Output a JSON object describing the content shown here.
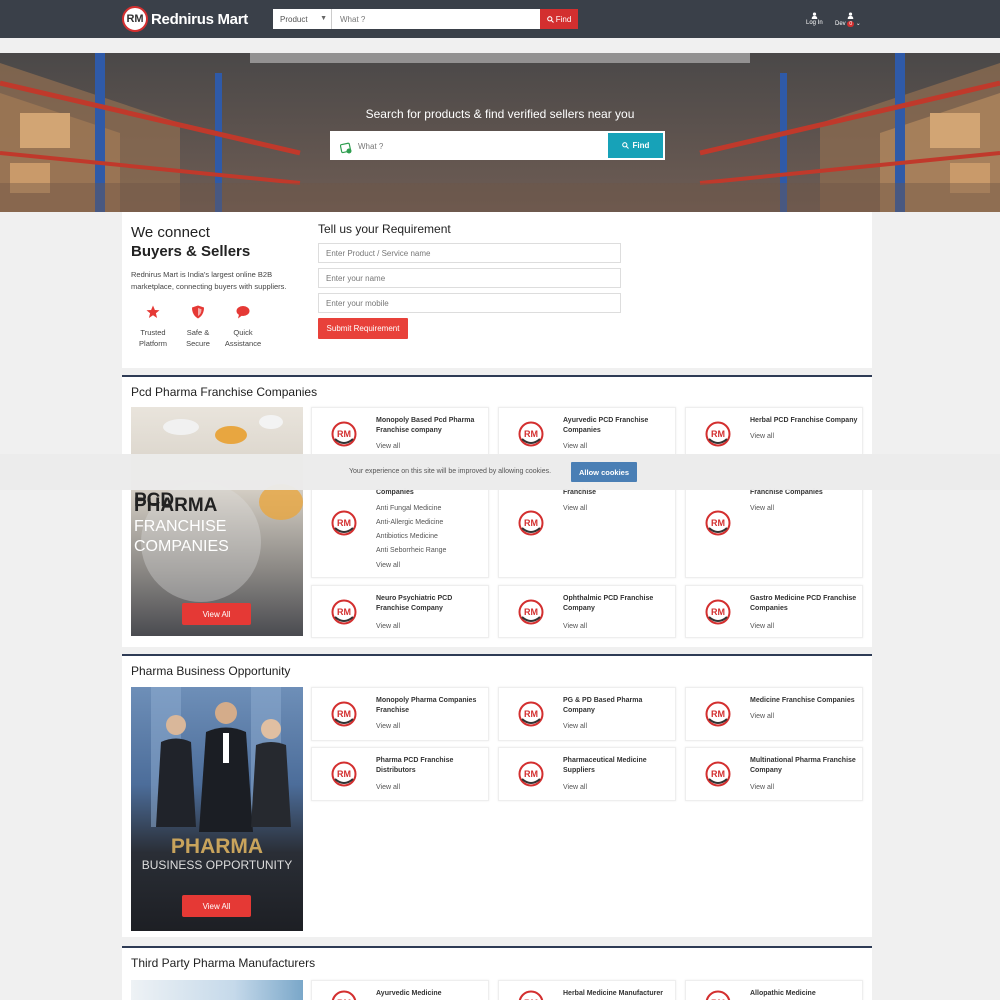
{
  "header": {
    "brand": "Rednirus Mart",
    "logo_mark": "RM",
    "search_category": "Product",
    "search_placeholder": "What ?",
    "find_label": "Find",
    "login_label": "Log In",
    "user_label": "Dev",
    "user_badge": "0"
  },
  "banner": {
    "title": "Search for products & find verified sellers near you",
    "search_placeholder": "What ?",
    "find_label": "Find"
  },
  "connect": {
    "heading_line1": "We connect",
    "heading_line2": "Buyers & Sellers",
    "description": "Rednirus Mart is India's largest online B2B marketplace, connecting buyers with suppliers.",
    "features": [
      {
        "icon": "star-icon",
        "line1": "Trusted",
        "line2": "Platform"
      },
      {
        "icon": "shield-icon",
        "line1": "Safe &",
        "line2": "Secure"
      },
      {
        "icon": "chat-icon",
        "line1": "Quick",
        "line2": "Assistance"
      }
    ]
  },
  "requirement": {
    "title": "Tell us your Requirement",
    "product_placeholder": "Enter Product / Service name",
    "name_placeholder": "Enter your name",
    "mobile_placeholder": "Enter your mobile",
    "submit_label": "Submit Requirement"
  },
  "sections": [
    {
      "title": "Pcd Pharma Franchise Companies",
      "promo_line1": "PCD",
      "promo_line2": "PHARMA",
      "promo_line3": "FRANCHISE",
      "promo_line4": "COMPANIES",
      "promo_button": "View All",
      "cards": [
        {
          "title": "Monopoly Based Pcd Pharma Franchise company",
          "view": "View all"
        },
        {
          "title": "Ayurvedic PCD Franchise Companies",
          "view": "View all"
        },
        {
          "title": "Herbal PCD Franchise Company",
          "view": "View all"
        },
        {
          "title": "Companies",
          "subs": [
            "Anti Fungal Medicine",
            "Anti-Allergic Medicine",
            "Antibiotics Medicine",
            "Anti Seborrheic Range"
          ],
          "view": "View all"
        },
        {
          "title": "Franchise",
          "view": "View all"
        },
        {
          "title": "Franchise Companies",
          "view": "View all"
        },
        {
          "title": "Neuro Psychiatric PCD Franchise Company",
          "view": "View all"
        },
        {
          "title": "Ophthalmic PCD Franchise Company",
          "view": "View all"
        },
        {
          "title": "Gastro Medicine PCD Franchise Companies",
          "view": "View all"
        }
      ]
    },
    {
      "title": "Pharma Business Opportunity",
      "promo_line1": "PHARMA",
      "promo_line2": "BUSINESS OPPORTUNITY",
      "promo_button": "View All",
      "cards": [
        {
          "title": "Monopoly Pharma Companies Franchise",
          "view": "View all"
        },
        {
          "title": "PG & PD Based Pharma Company",
          "view": "View all"
        },
        {
          "title": "Medicine Franchise Companies",
          "view": "View all"
        },
        {
          "title": "Pharma PCD Franchise Distributors",
          "view": "View all"
        },
        {
          "title": "Pharmaceutical Medicine Suppliers",
          "view": "View all"
        },
        {
          "title": "Multinational Pharma Franchise Company",
          "view": "View all"
        }
      ]
    },
    {
      "title": "Third Party Pharma Manufacturers",
      "cards": [
        {
          "title": "Ayurvedic Medicine Manufacturer"
        },
        {
          "title": "Herbal Medicine Manufacturer"
        },
        {
          "title": "Allopathic Medicine Manufacturer"
        }
      ]
    }
  ],
  "cookie": {
    "text": "Your experience on this site will be improved by allowing cookies.",
    "button": "Allow cookies"
  },
  "colors": {
    "header_bg": "#3a4049",
    "accent_red": "#d32f2f",
    "find_teal": "#17a2b8",
    "section_rule": "#2e3b55",
    "cookie_button": "#4a7fb5"
  }
}
